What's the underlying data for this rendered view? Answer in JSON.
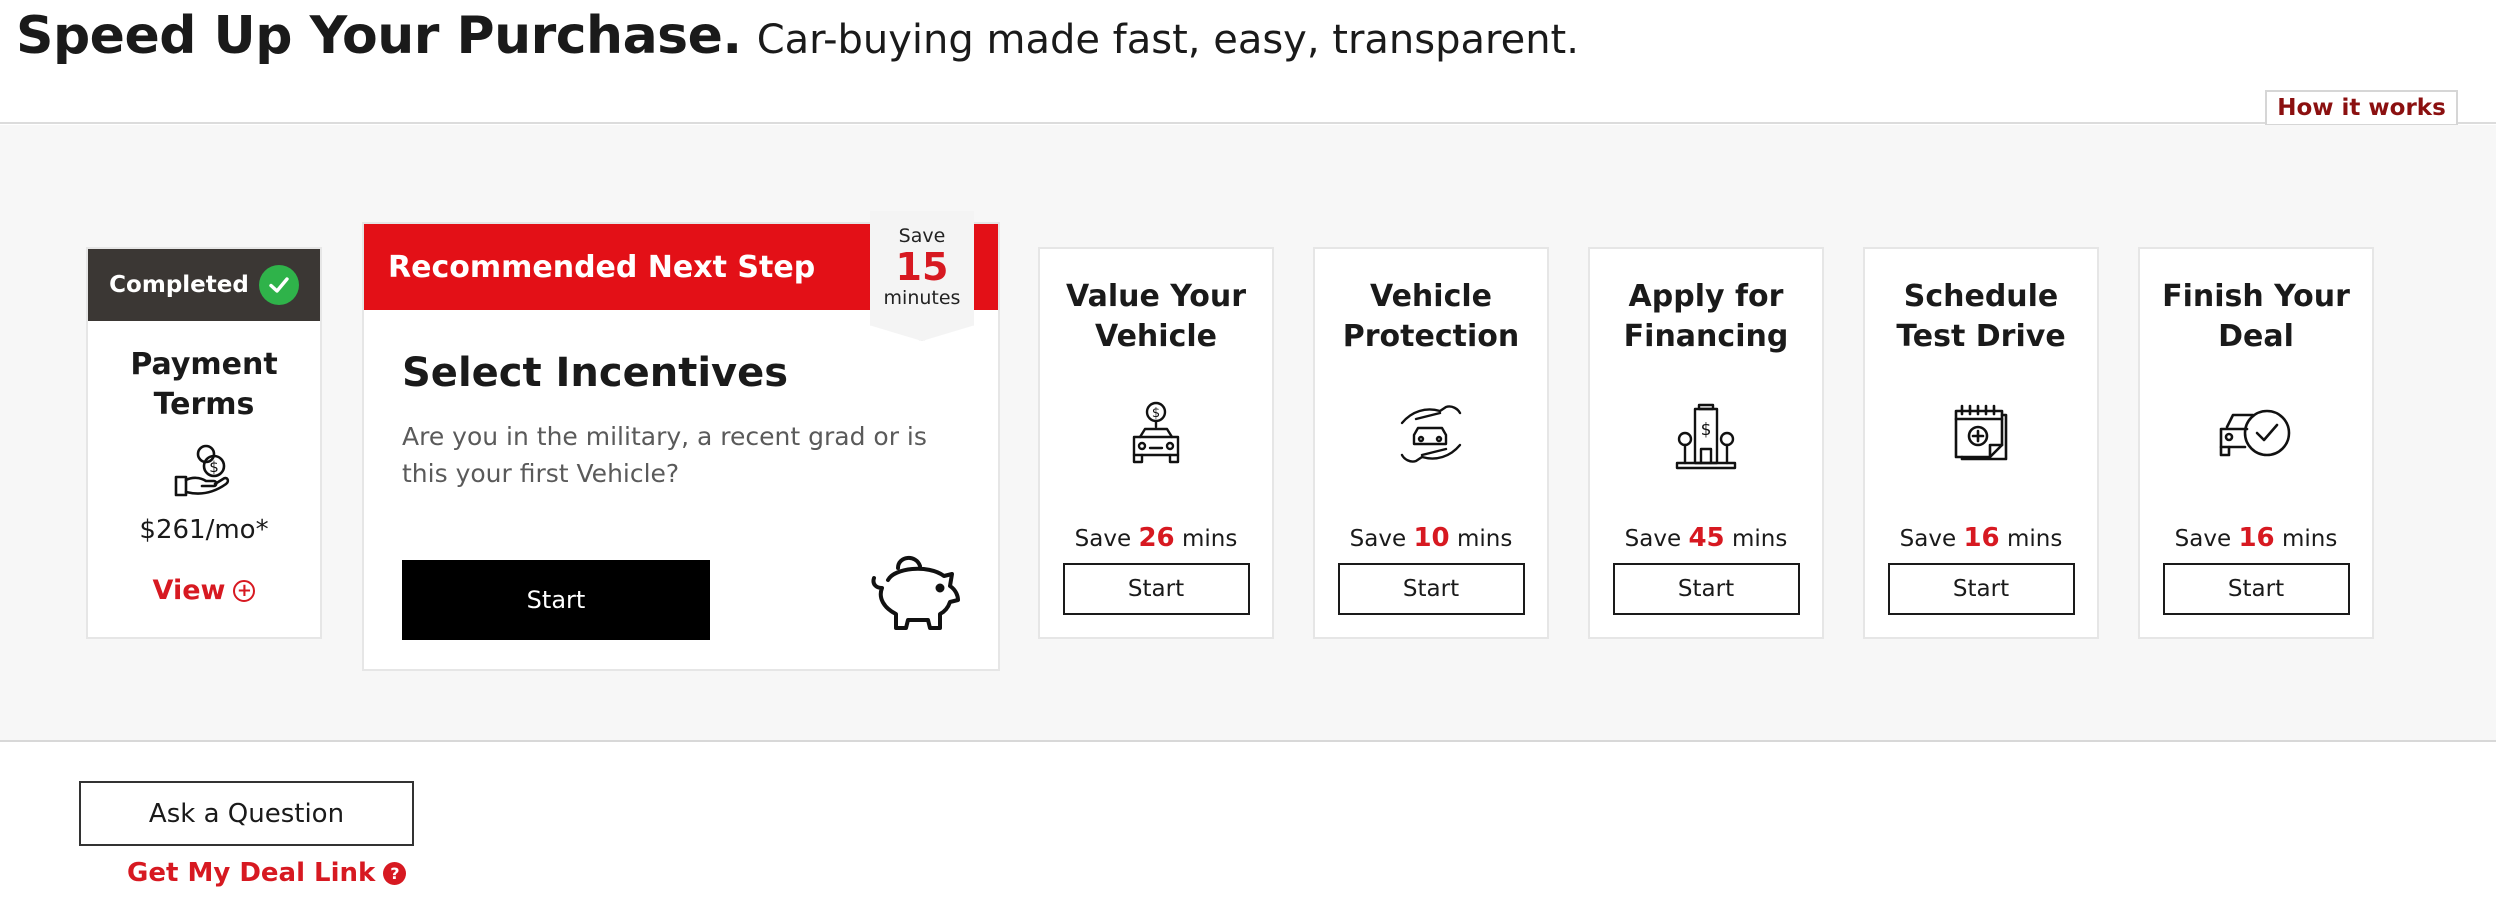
{
  "header": {
    "headline": "Speed Up Your Purchase.",
    "subheadline": "Car-buying made fast, easy, transparent.",
    "how_it_works": "How it works"
  },
  "completed_card": {
    "badge": "Completed",
    "title_line1": "Payment",
    "title_line2": "Terms",
    "icon": "hand-coin-icon",
    "price": "$261/mo*",
    "view_label": "View"
  },
  "recommended": {
    "banner": "Recommended Next Step",
    "ribbon_save": "Save",
    "ribbon_minutes_value": "15",
    "ribbon_minutes_label": "minutes",
    "title": "Select Incentives",
    "description": "Are you in the military, a recent grad or is this your first Vehicle?",
    "start_label": "Start",
    "icon": "piggy-bank-icon"
  },
  "steps": [
    {
      "title_line1": "Value Your",
      "title_line2": "Vehicle",
      "save_prefix": "Save",
      "save_value": "26",
      "save_suffix": "mins",
      "start_label": "Start",
      "icon": "car-value-icon"
    },
    {
      "title_line1": "Vehicle",
      "title_line2": "Protection",
      "save_prefix": "Save",
      "save_value": "10",
      "save_suffix": "mins",
      "start_label": "Start",
      "icon": "hands-car-icon"
    },
    {
      "title_line1": "Apply for",
      "title_line2": "Financing",
      "save_prefix": "Save",
      "save_value": "45",
      "save_suffix": "mins",
      "start_label": "Start",
      "icon": "bank-building-icon"
    },
    {
      "title_line1": "Schedule",
      "title_line2": "Test Drive",
      "save_prefix": "Save",
      "save_value": "16",
      "save_suffix": "mins",
      "start_label": "Start",
      "icon": "calendar-add-icon"
    },
    {
      "title_line1": "Finish Your",
      "title_line2": "Deal",
      "save_prefix": "Save",
      "save_value": "16",
      "save_suffix": "mins",
      "start_label": "Start",
      "icon": "car-check-icon"
    }
  ],
  "footer": {
    "ask_label": "Ask a Question",
    "deal_link_label": "Get My Deal Link"
  },
  "colors": {
    "accent_red": "#d71921",
    "banner_red": "#e31017",
    "completed_bar": "#3b3734",
    "check_green": "#2fb34a"
  }
}
